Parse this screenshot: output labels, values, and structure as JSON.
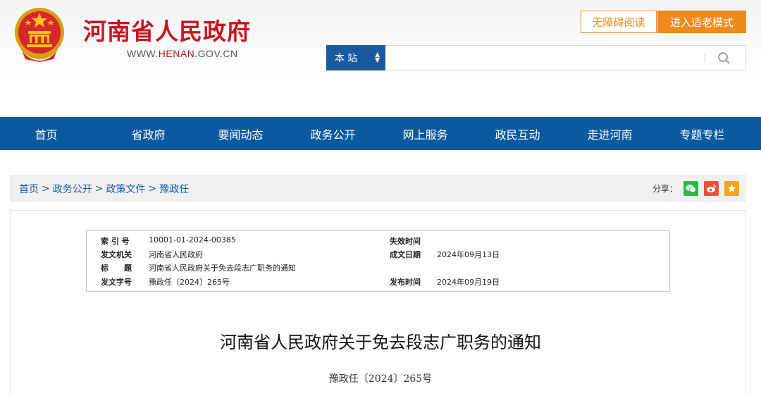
{
  "header": {
    "site_title": "河南省人民政府",
    "url_prefix": "WWW.",
    "url_highlight": "HENAN",
    "url_suffix": ".GOV.CN",
    "accessibility_label": "无障碍阅读",
    "elder_mode_label": "进入适老模式",
    "accent_color": "#f08a1c",
    "brand_red": "#c8161d"
  },
  "search": {
    "scope_label": "本站",
    "placeholder": "",
    "icon": "search-icon"
  },
  "nav": {
    "items": [
      "首页",
      "省政府",
      "要闻动态",
      "政务公开",
      "网上服务",
      "政民互动",
      "走进河南",
      "专题专栏"
    ],
    "color": "#0d59a0"
  },
  "breadcrumb": {
    "items": [
      "首页",
      "政务公开",
      "政策文件",
      "豫政任"
    ],
    "separator": ">"
  },
  "share": {
    "label": "分享：",
    "icons": [
      "wechat-icon",
      "weibo-icon",
      "favorite-icon"
    ]
  },
  "meta": {
    "index_label": "索 引 号",
    "index_value": "10001-01-2024-00385",
    "expiry_label": "失效时间",
    "expiry_value": "",
    "issuer_label": "发文机关",
    "issuer_value": "河南省人民政府",
    "written_label": "成文日期",
    "written_value": "2024年09月13日",
    "title_label": "标　　题",
    "title_value": "河南省人民政府关于免去段志广职务的通知",
    "docno_label": "发文字号",
    "docno_value": "豫政任〔2024〕265号",
    "published_label": "发布时间",
    "published_value": "2024年09月19日"
  },
  "document": {
    "title": "河南省人民政府关于免去段志广职务的通知",
    "number": "豫政任〔2024〕265号"
  }
}
